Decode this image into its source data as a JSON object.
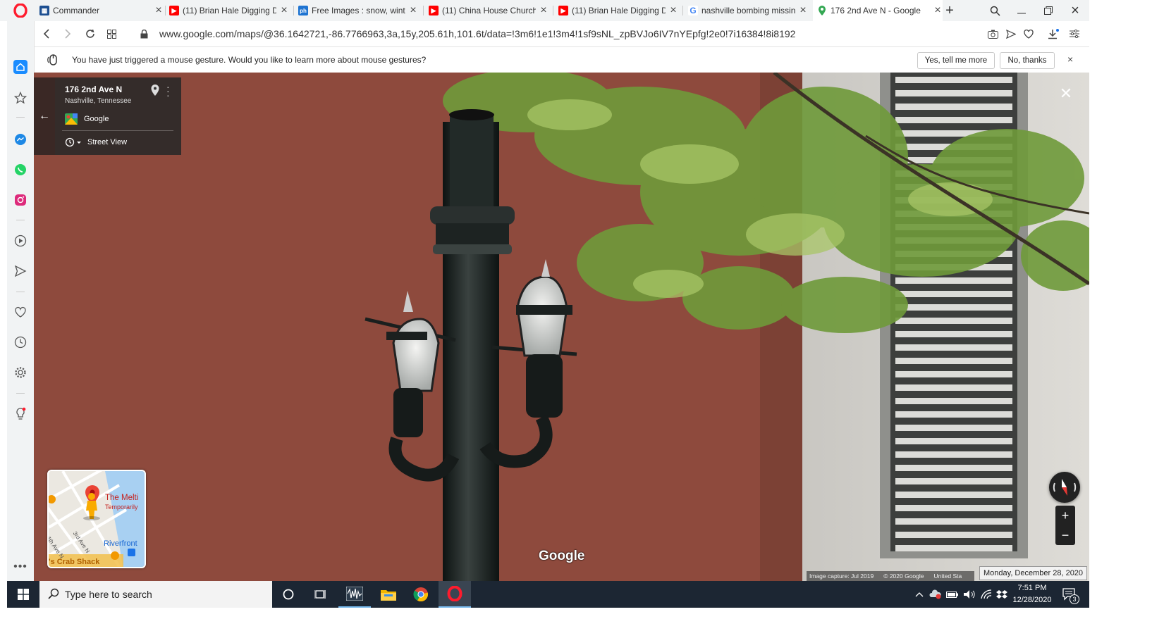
{
  "browser": {
    "tabs": [
      {
        "icon": "commander-icon",
        "title": "Commander",
        "favicon_color": "#2b579a"
      },
      {
        "icon": "youtube-icon",
        "title": "(11) Brian Hale Digging D",
        "favicon_color": "#ff0000"
      },
      {
        "icon": "pixabay-icon",
        "title": "Free Images : snow, winte",
        "favicon_color": "#1f74d1"
      },
      {
        "icon": "youtube-icon",
        "title": "(11) China House Church",
        "favicon_color": "#ff0000"
      },
      {
        "icon": "youtube-icon",
        "title": "(11) Brian Hale Digging D",
        "favicon_color": "#ff0000"
      },
      {
        "icon": "google-icon",
        "title": "nashville bombing missin",
        "favicon_color": "#4285f4"
      },
      {
        "icon": "maps-pin-icon",
        "title": "176 2nd Ave N - Google",
        "favicon_color": "#34a853",
        "active": true
      }
    ],
    "url": "www.google.com/maps/@36.1642721,-86.7766963,3a,15y,205.61h,101.6t/data=!3m6!1e1!3m4!1sf9sNL_zpBVJo6IV7nYEpfg!2e0!7i16384!8i8192",
    "accent": "#ff1b2d"
  },
  "notification": {
    "text": "You have just triggered a mouse gesture. Would you like to learn more about mouse gestures?",
    "yes_label": "Yes, tell me more",
    "no_label": "No, thanks"
  },
  "streetview": {
    "address_line1": "176 2nd Ave N",
    "address_line2": "Nashville, Tennessee",
    "provider": "Google",
    "mode_label": "Street View",
    "watermark": "Google",
    "attribution": {
      "capture": "Image capture: Jul 2019",
      "copyright": "© 2020 Google",
      "region": "United Sta"
    },
    "minimap": {
      "place_name": "The Melti",
      "place_status": "Temporarily",
      "area": "Riverfront",
      "street_a": "4th Ave N",
      "street_b": "3rd Ave N",
      "restaurant": "'s Crab Shack"
    },
    "zoom_in": "+",
    "zoom_out": "−"
  },
  "tooltip": {
    "date": "Monday, December 28, 2020"
  },
  "taskbar": {
    "search_placeholder": "Type here to search",
    "time": "7:51 PM",
    "date": "12/28/2020",
    "notification_count": "3"
  }
}
